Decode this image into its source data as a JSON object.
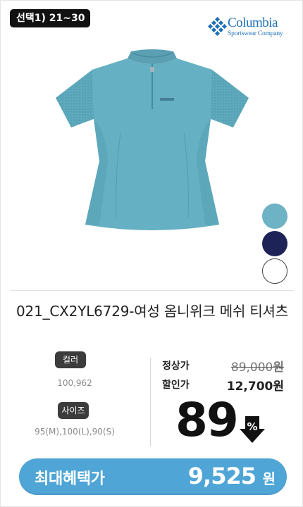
{
  "badge": {
    "selection": "선택1) 21~30"
  },
  "brand": {
    "name": "Columbia",
    "sub": "Sportswear Company"
  },
  "product": {
    "title": "021_CX2YL6729-여성 옴니위크 메쉬 티셔츠",
    "image_alt": "여성 옴니위크 메쉬 티셔츠 (turquoise)",
    "swatches": [
      {
        "name": "turquoise",
        "hex": "#6db2c5"
      },
      {
        "name": "navy",
        "hex": "#1d2356"
      },
      {
        "name": "white",
        "hex": "#ffffff"
      }
    ]
  },
  "options": {
    "color_label": "컬러",
    "color_values": "100,962",
    "size_label": "사이즈",
    "size_values": "95(M),100(L),90(S)"
  },
  "price": {
    "regular_label": "정상가",
    "regular_value": "89,000",
    "sale_label": "할인가",
    "sale_value": "12,700",
    "currency": "원",
    "discount_value": "89",
    "discount_unit": "%"
  },
  "benefit": {
    "label": "최대혜택가",
    "value": "9,525",
    "currency": "원",
    "color": "#4ea5d6"
  }
}
